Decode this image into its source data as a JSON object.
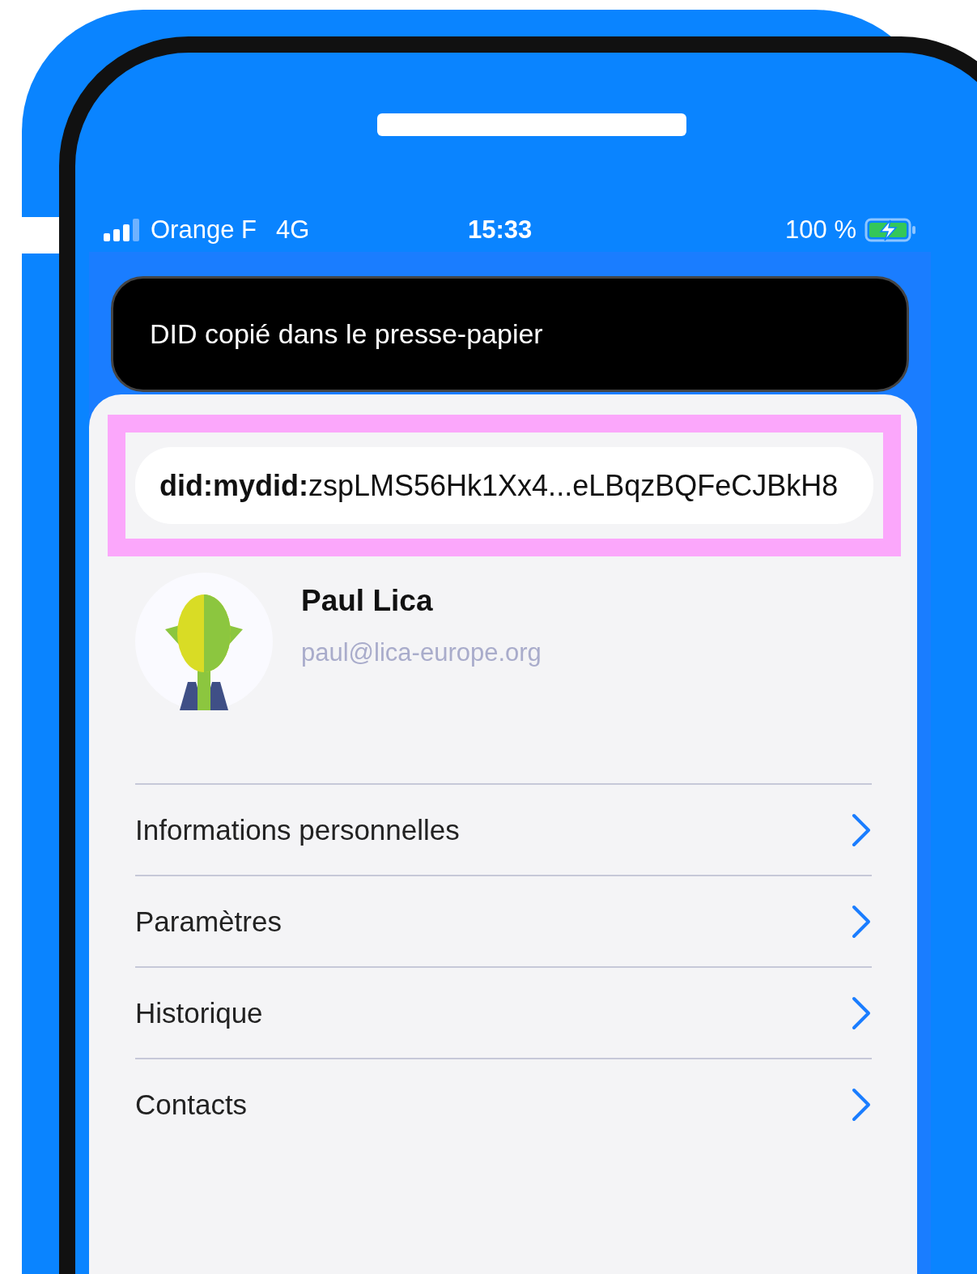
{
  "status_bar": {
    "carrier": "Orange F",
    "network": "4G",
    "time": "15:33",
    "battery": "100 %"
  },
  "toast": {
    "message": "DID copié dans le presse-papier"
  },
  "did_field": {
    "value": "**did:mydid:**zspLMS56Hk1Xx4...eLBqzBQFeCJBkH8"
  },
  "profile": {
    "name": "Paul Lica",
    "email": "paul@lica-europe.org"
  },
  "menu": [
    {
      "label": "Informations personnelles"
    },
    {
      "label": "Paramètres"
    },
    {
      "label": "Historique"
    },
    {
      "label": "Contacts"
    }
  ]
}
